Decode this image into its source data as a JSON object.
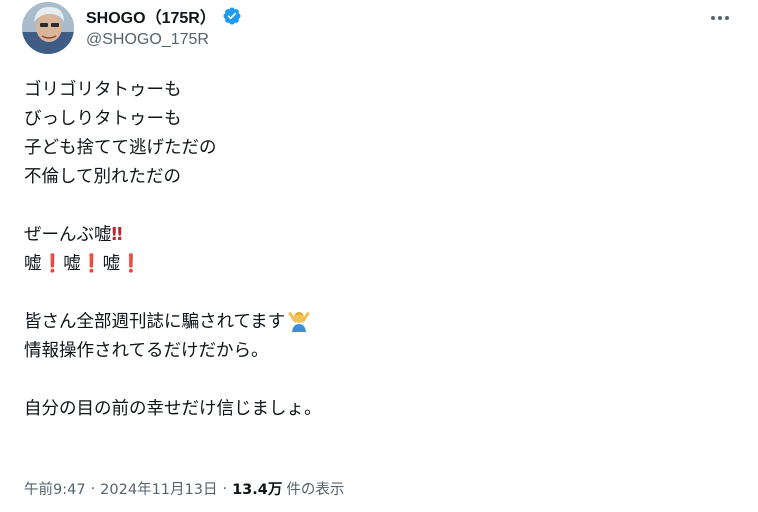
{
  "author": {
    "display_name": "SHOGO（175R）",
    "handle": "@SHOGO_175R",
    "verified_icon": "verified-badge-icon",
    "avatar_icon": "avatar"
  },
  "tweet": {
    "lines": [
      "ゴリゴリタトゥーも",
      "びっしりタトゥーも",
      "子ども捨てて逃げただの",
      "不倫して別れただの",
      "",
      "ぜーんぶ嘘",
      "嘘",
      "",
      "皆さん全部週刊誌に騙されてます",
      "情報操作されてるだけだから。",
      "",
      "自分の目の前の幸せだけ信じましょ。"
    ],
    "double_bang": "‼",
    "single_bang": "❗",
    "lie_word": "嘘",
    "emoji_name": "person-gesturing-ok-icon"
  },
  "meta": {
    "time": "午前9:47",
    "date": "2024年11月13日",
    "separator": "·",
    "views_count": "13.4万",
    "views_label": "件の表示"
  },
  "colors": {
    "text": "#0f1419",
    "secondary": "#536471",
    "verified": "#1d9bf0",
    "bang": "#c0262e"
  }
}
